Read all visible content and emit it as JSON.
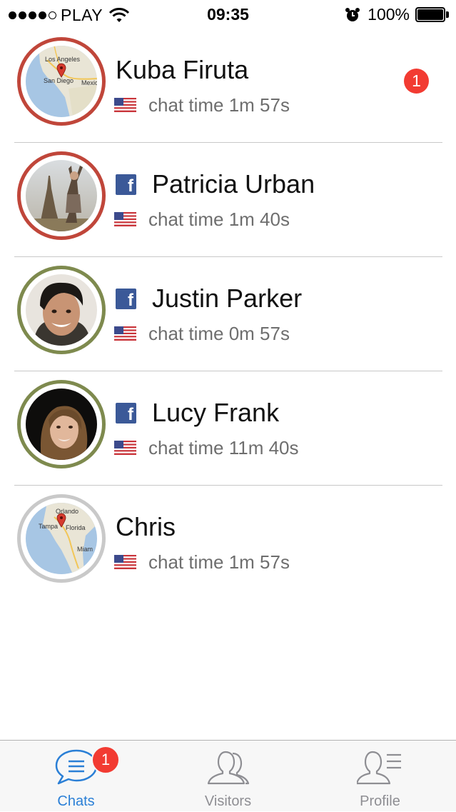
{
  "status_bar": {
    "carrier": "PLAY",
    "time": "09:35",
    "battery": "100%",
    "signal_bars_filled": 4,
    "signal_bars_total": 5,
    "icons": [
      "signal-dots-icon",
      "wifi-icon",
      "alarm-icon",
      "battery-icon"
    ]
  },
  "chats": [
    {
      "name": "Kuba Firuta",
      "chat_time": "chat time 1m 57s",
      "avatar": "map-los-angeles",
      "avatar_labels": [
        "Los Angeles",
        "San Diego",
        "Mexic"
      ],
      "ring_color": "#c0463a",
      "facebook": false,
      "unread": "1"
    },
    {
      "name": "Patricia Urban",
      "chat_time": "chat time 1m 40s",
      "avatar": "photo-eiffel-tower",
      "ring_color": "#c0463a",
      "facebook": true,
      "fb_letter": "f"
    },
    {
      "name": "Justin Parker",
      "chat_time": "chat time 0m 57s",
      "avatar": "photo-man",
      "ring_color": "#7e8a4e",
      "facebook": true,
      "fb_letter": "f"
    },
    {
      "name": "Lucy Frank",
      "chat_time": "chat time 11m 40s",
      "avatar": "photo-woman",
      "ring_color": "#7e8a4e",
      "facebook": true,
      "fb_letter": "f"
    },
    {
      "name": "Chris",
      "chat_time": "chat time 1m 57s",
      "avatar": "map-florida",
      "avatar_labels": [
        "Orlando",
        "Tampa",
        "Florida",
        "Miam"
      ],
      "ring_color": "#c9c9c9",
      "facebook": false
    }
  ],
  "tab_bar": {
    "tabs": [
      {
        "label": "Chats",
        "icon": "chat-bubble-icon",
        "active": true,
        "badge": "1"
      },
      {
        "label": "Visitors",
        "icon": "visitors-icon",
        "active": false
      },
      {
        "label": "Profile",
        "icon": "profile-icon",
        "active": false
      }
    ]
  },
  "colors": {
    "accent": "#2a7fd6",
    "badge": "#f23b32",
    "ring_red": "#c0463a",
    "ring_green": "#7e8a4e",
    "ring_gray": "#c9c9c9",
    "facebook": "#3b5998"
  }
}
